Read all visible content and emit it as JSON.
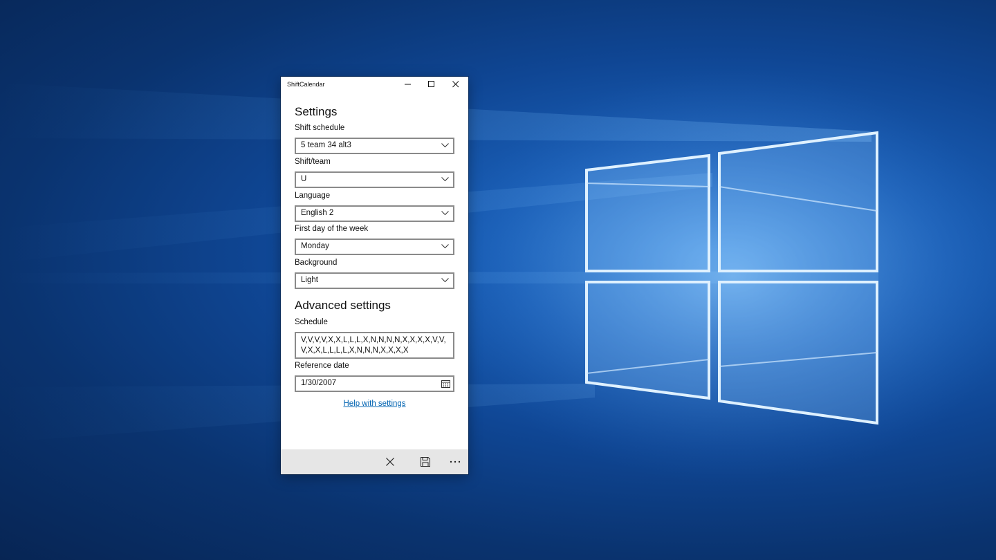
{
  "window": {
    "title": "ShiftCalendar",
    "controls": [
      "minimize-icon",
      "maximize-icon",
      "close-icon"
    ]
  },
  "settings": {
    "heading": "Settings",
    "shift_schedule": {
      "label": "Shift schedule",
      "value": "5 team 34 alt3"
    },
    "shift_team": {
      "label": "Shift/team",
      "value": "U"
    },
    "language": {
      "label": "Language",
      "value": "English 2"
    },
    "first_day": {
      "label": "First day of the week",
      "value": "Monday"
    },
    "background": {
      "label": "Background",
      "value": "Light"
    }
  },
  "advanced": {
    "heading": "Advanced settings",
    "schedule": {
      "label": "Schedule",
      "value": "V,V,V,V,X,X,L,L,L,X,N,N,N,N,X,X,X,X,V,V,V,X,X,L,L,L,L,X,N,N,N,X,X,X,X"
    },
    "reference_date": {
      "label": "Reference date",
      "value": "1/30/2007"
    },
    "help_link": "Help with settings"
  },
  "command_bar": {
    "icons": [
      "cancel-icon",
      "save-icon",
      "more-icon"
    ]
  },
  "colors": {
    "accent_link": "#0063b1",
    "command_bar": "#e6e6e6",
    "desktop": "#0f4694"
  }
}
